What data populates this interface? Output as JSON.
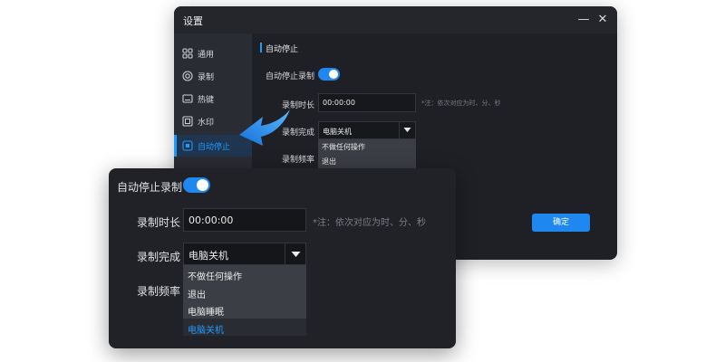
{
  "window": {
    "title": "设置",
    "minimize_glyph": "—",
    "close_glyph": "✕"
  },
  "sidebar": {
    "items": [
      {
        "label": "通用",
        "icon": "grid-icon"
      },
      {
        "label": "录制",
        "icon": "record-icon"
      },
      {
        "label": "热键",
        "icon": "keyboard-icon"
      },
      {
        "label": "水印",
        "icon": "watermark-icon"
      },
      {
        "label": "自动停止",
        "icon": "stop-icon",
        "active": true
      }
    ]
  },
  "section": {
    "title": "自动停止"
  },
  "settings": {
    "auto_stop_label": "自动停止录制",
    "auto_stop_enabled": true,
    "duration_label": "录制时长",
    "duration_value": "00:00:00",
    "duration_note": "*注：依次对应为时、分、秒",
    "complete_label": "录制完成",
    "complete_value": "电脑关机",
    "frequency_label": "录制频率",
    "complete_options": [
      "不做任何操作",
      "退出",
      "电脑睡眠",
      "电脑关机"
    ],
    "complete_options_back_visible": [
      "不做任何操作",
      "退出"
    ]
  },
  "buttons": {
    "confirm": "确定"
  },
  "colors": {
    "accent": "#1e88f0",
    "window_bg": "#1e2026",
    "sidebar_bg": "#2a2c33",
    "dropdown_bg": "#3c3e45",
    "selected_text": "#1e9bff"
  }
}
